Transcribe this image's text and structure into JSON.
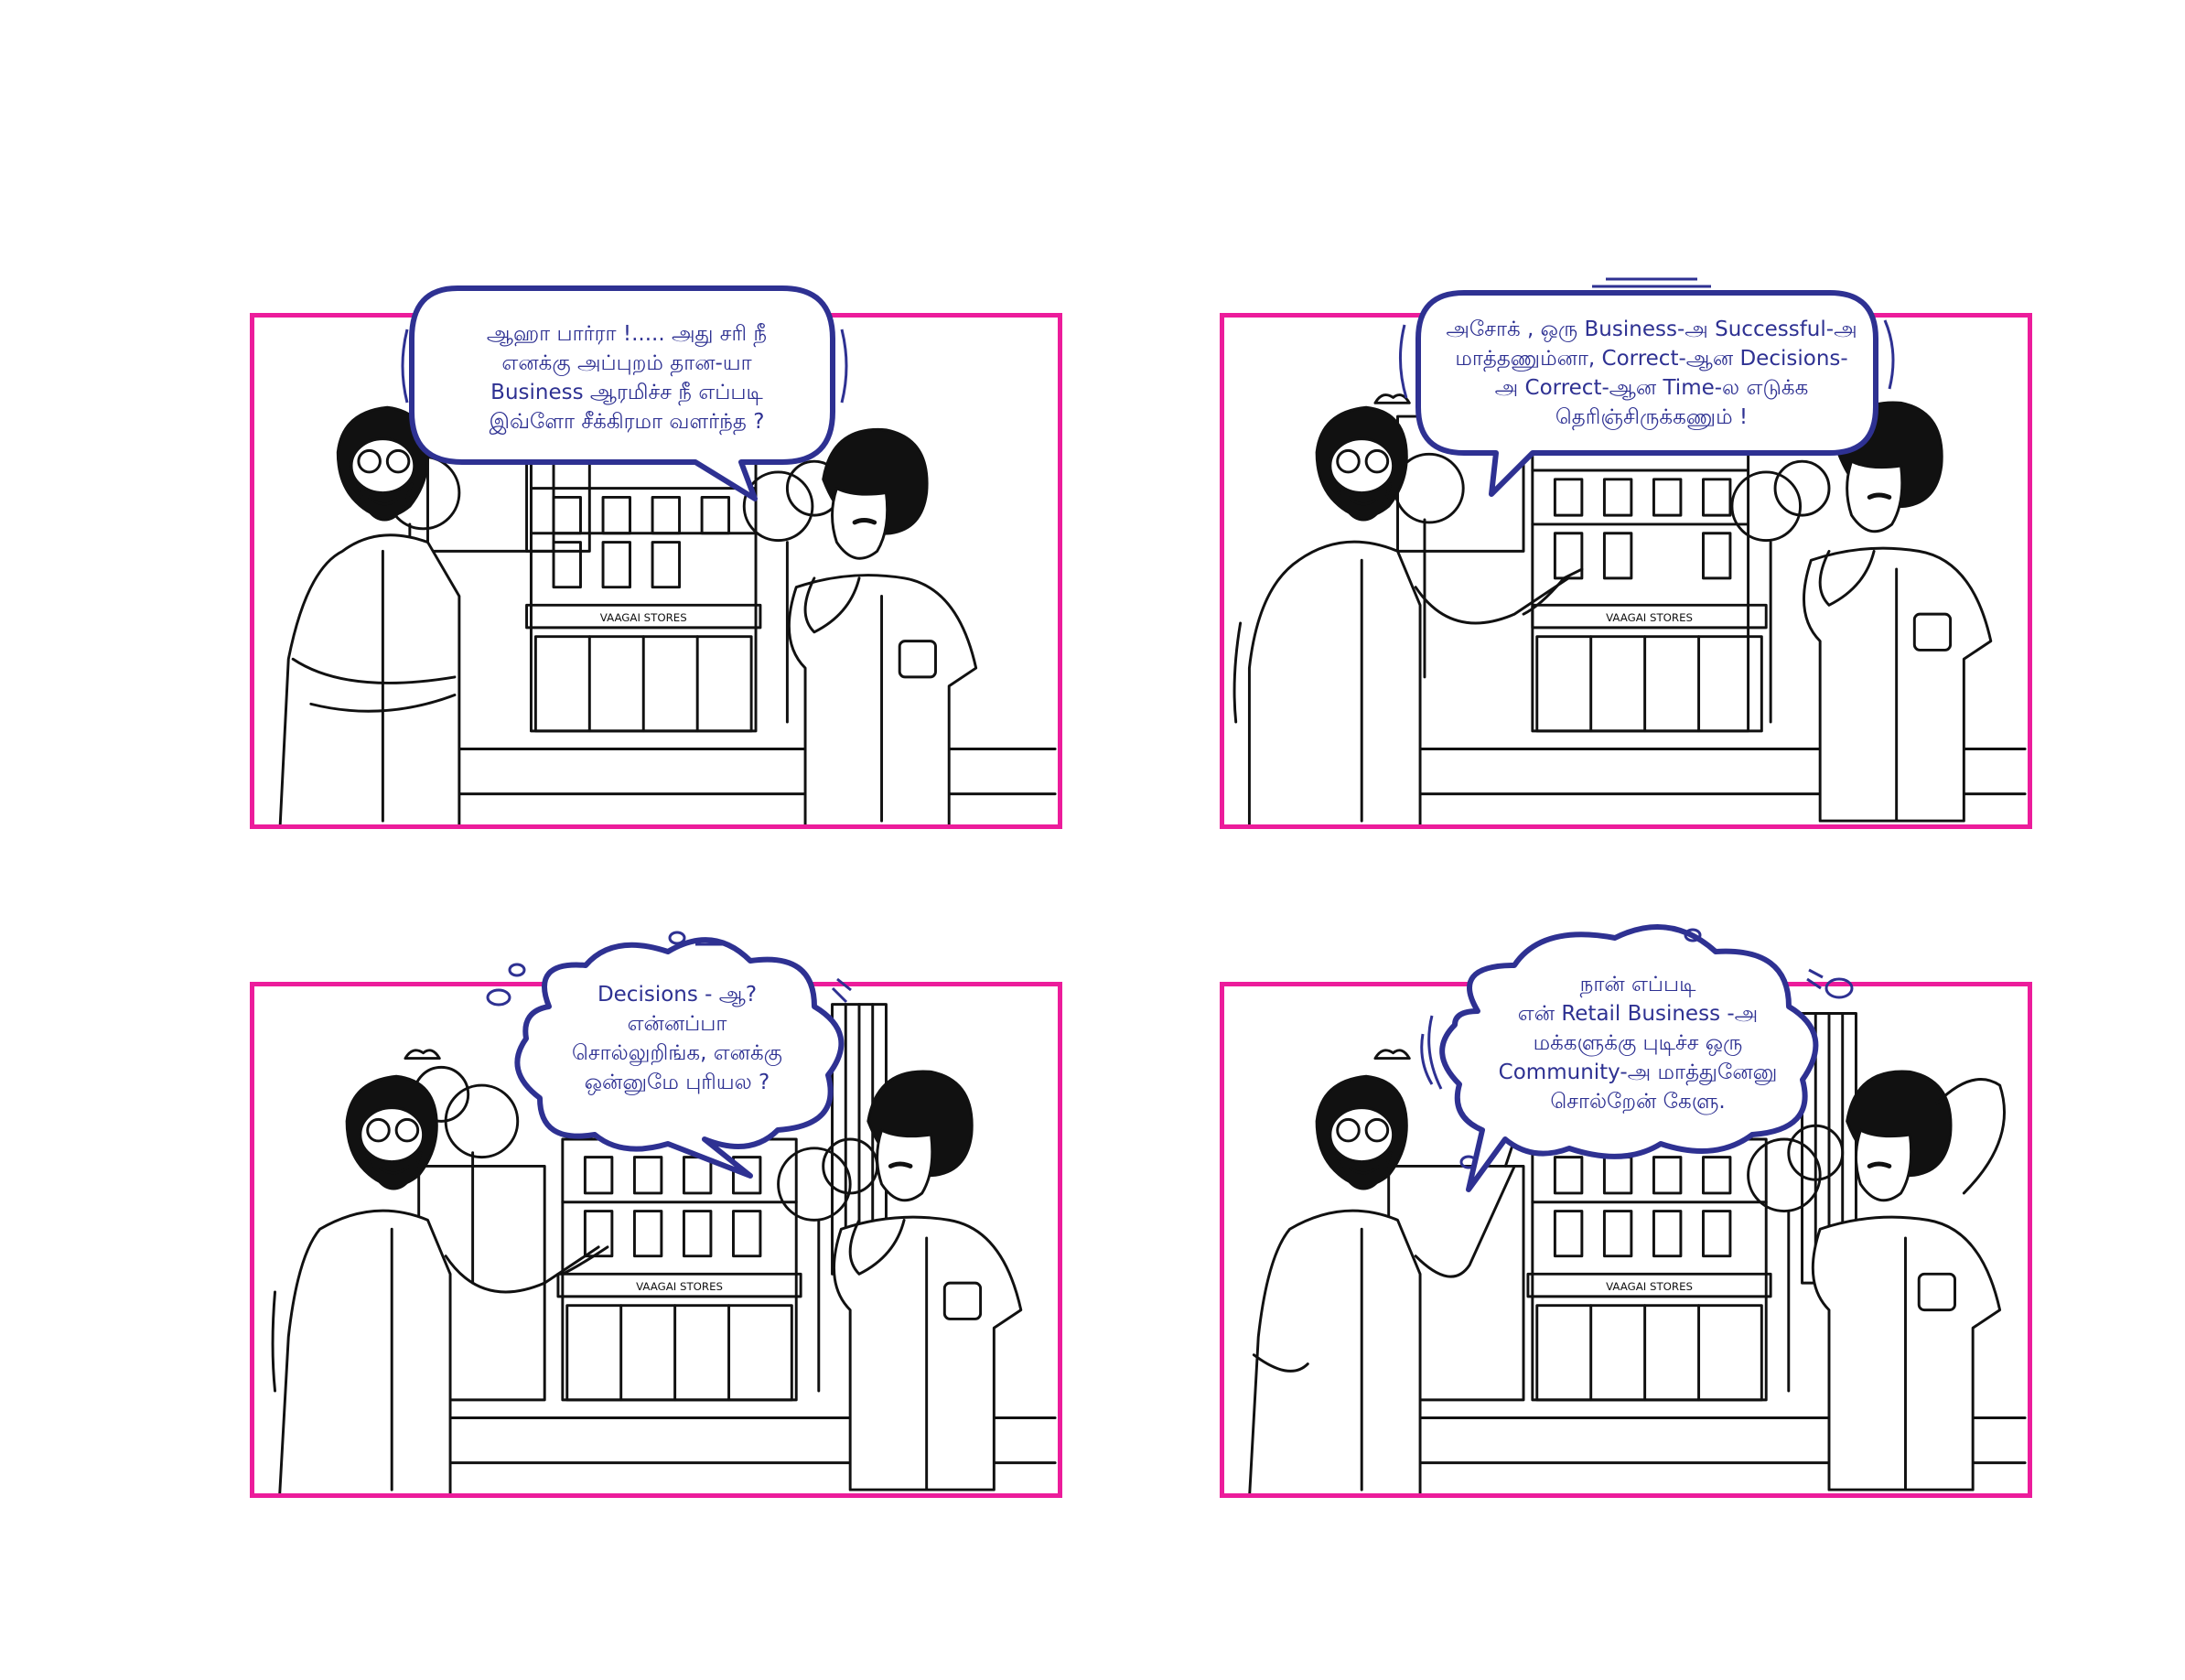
{
  "colors": {
    "panel_border": "#ec1c9b",
    "bubble_stroke": "#2e3192",
    "text": "#2e3192",
    "ink": "#111111"
  },
  "panels": [
    {
      "store_sign": "VAAGAI STORES",
      "bubble_lines": [
        "ஆஹா பார்ரா !..... அது சரி நீ",
        "எனக்கு அப்புறம் தான-யா",
        "Business ஆரமிச்ச நீ எப்படி",
        "இவ்ளோ சீக்கிரமா வளர்ந்த ?"
      ]
    },
    {
      "store_sign": "VAAGAI STORES",
      "bubble_lines": [
        "அசோக் , ஒரு  Business-அ Successful-அ",
        "மாத்தணும்னா, Correct-ஆன Decisions-",
        "அ  Correct-ஆன Time-ல  எடுக்க",
        "தெரிஞ்சிருக்கணும் !"
      ]
    },
    {
      "store_sign": "VAAGAI STORES",
      "bubble_lines": [
        "Decisions - ஆ?",
        "என்னப்பா",
        "சொல்லுறிங்க, எனக்கு",
        "ஒன்னுமே புரியல ?"
      ]
    },
    {
      "store_sign": "VAAGAI STORES",
      "bubble_lines": [
        "நான் எப்படி",
        "என் Retail Business -அ",
        "மக்களுக்கு புடிச்ச ஒரு",
        "Community-அ மாத்துனேனு",
        "சொல்றேன் கேளு."
      ]
    }
  ]
}
